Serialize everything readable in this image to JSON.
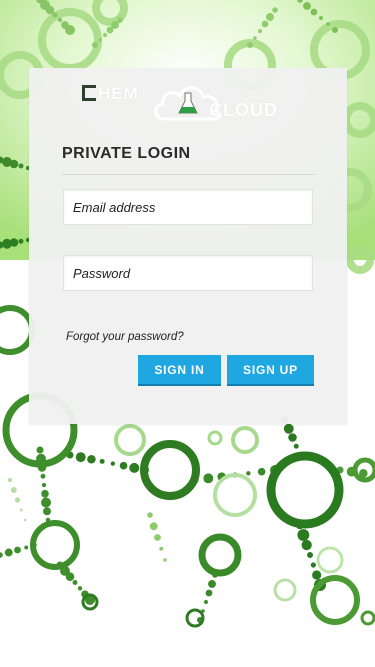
{
  "brand": {
    "logo_letter": "C",
    "logo_text_left": "HEM",
    "logo_text_right": "CLOUD",
    "accent_green": "#3d8c2e",
    "logo_icon": "flask-in-cloud-icon"
  },
  "login": {
    "title": "PRIVATE LOGIN",
    "email_placeholder": "Email address",
    "password_placeholder": "Password",
    "forgot_label": "Forgot your password?",
    "signin_label": "SIGN IN",
    "signup_label": "SIGN UP",
    "button_color": "#1ea7e1"
  },
  "background": {
    "theme": "green-molecule-network"
  }
}
